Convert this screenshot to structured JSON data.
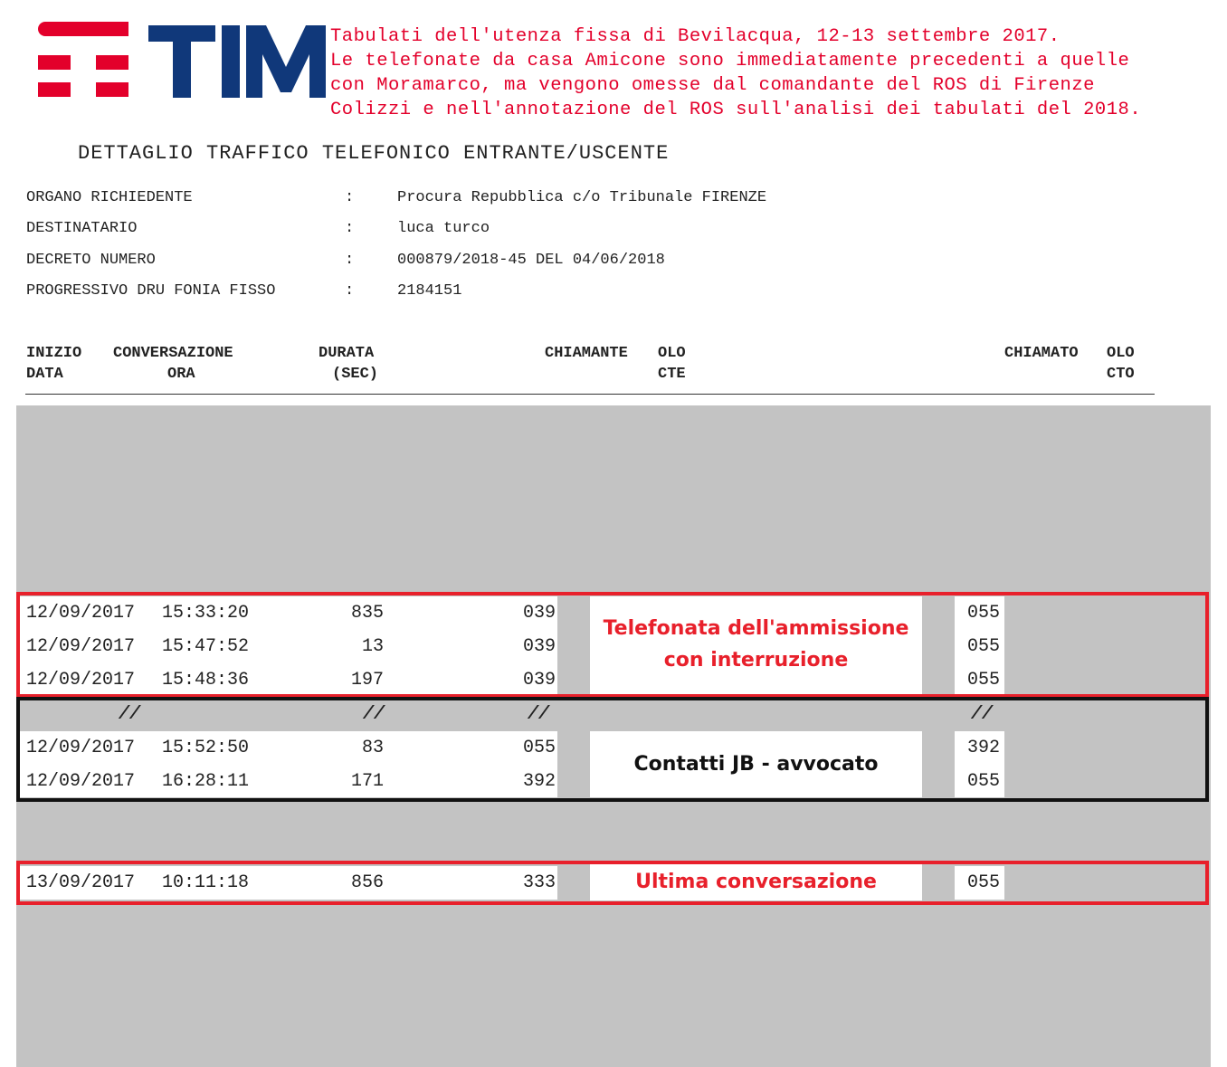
{
  "logo": {
    "brand_text": "TIM",
    "colors": {
      "red": "#e3002b",
      "blue": "#10387a"
    }
  },
  "note_lines": [
    "Tabulati dell'utenza fissa di Bevilacqua, 12-13 settembre 2017.",
    "Le telefonate da casa Amicone sono immediatamente precedenti a quelle",
    "con Moramarco, ma vengono omesse dal comandante del ROS di Firenze",
    "Colizzi e nell'annotazione del ROS sull'analisi dei tabulati del 2018."
  ],
  "doc_title": "DETTAGLIO TRAFFICO TELEFONICO ENTRANTE/USCENTE",
  "meta": [
    {
      "label": "ORGANO RICHIEDENTE",
      "colon": ":",
      "value": "Procura Repubblica c/o Tribunale FIRENZE"
    },
    {
      "label": "DESTINATARIO",
      "colon": ":",
      "value": "luca turco"
    },
    {
      "label": "DECRETO NUMERO",
      "colon": ":",
      "value": "000879/2018-45 DEL 04/06/2018"
    },
    {
      "label": "PROGRESSIVO DRU FONIA FISSO",
      "colon": ":",
      "value": "2184151"
    }
  ],
  "table_header": {
    "inizio": "INIZIO",
    "data": "DATA",
    "conversazione": "CONVERSAZIONE",
    "ora": "ORA",
    "durata": "DURATA",
    "sec": "(SEC)",
    "chiamante": "CHIAMANTE",
    "olo1": "OLO",
    "cte": "CTE",
    "chiamato": "CHIAMATO",
    "olo2": "OLO",
    "cto": "CTO"
  },
  "rows": [
    {
      "date": "12/09/2017",
      "time": "15:33:20",
      "duration": "835",
      "caller": "039",
      "called": "055"
    },
    {
      "date": "12/09/2017",
      "time": "15:47:52",
      "duration": "13",
      "caller": "039",
      "called": "055"
    },
    {
      "date": "12/09/2017",
      "time": "15:48:36",
      "duration": "197",
      "caller": "039",
      "called": "055"
    },
    {
      "date": "12/09/2017",
      "time": "15:52:50",
      "duration": "83",
      "caller": "055",
      "called": "392"
    },
    {
      "date": "12/09/2017",
      "time": "16:28:11",
      "duration": "171",
      "caller": "392",
      "called": "055"
    },
    {
      "date": "13/09/2017",
      "time": "10:11:18",
      "duration": "856",
      "caller": "333",
      "called": "055"
    }
  ],
  "gap_marker": "//",
  "annotations": {
    "group1_line1": "Telefonata dell'ammissione",
    "group1_line2": "con interruzione",
    "group2": "Contatti JB - avvocato",
    "group3": "Ultima conversazione",
    "colors": {
      "red": "#e8202b",
      "black": "#111111"
    }
  }
}
